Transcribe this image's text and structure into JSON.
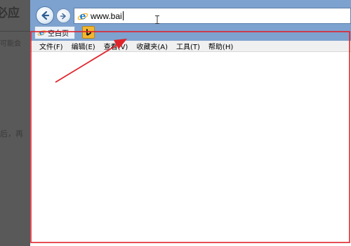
{
  "background_page": {
    "title_fragment": "必应",
    "line1_fragment": "可能会",
    "line2_fragment": "后，再"
  },
  "browser": {
    "address": {
      "value": "www.bai"
    },
    "tab": {
      "label": "空白页"
    },
    "new_tab_icon": "bing-icon",
    "menu": [
      {
        "label": "文件(F)"
      },
      {
        "label": "编辑(E)"
      },
      {
        "label": "查看(V)"
      },
      {
        "label": "收藏夹(A)"
      },
      {
        "label": "工具(T)"
      },
      {
        "label": "帮助(H)"
      }
    ]
  },
  "colors": {
    "titlebar": "#7da2cf",
    "annotation": "#e0232b",
    "ie_blue": "#1d7fd6",
    "bing_yellow": "#f3b62f"
  }
}
